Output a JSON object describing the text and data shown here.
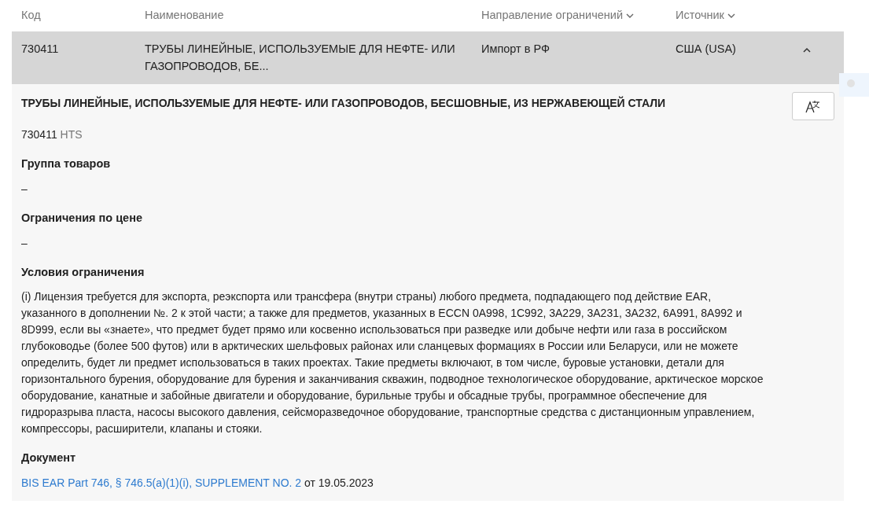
{
  "table": {
    "columns": [
      {
        "label": "Код",
        "sortable": false
      },
      {
        "label": "Наименование",
        "sortable": false
      },
      {
        "label": "Направление ограничений",
        "sortable": true
      },
      {
        "label": "Источник",
        "sortable": true
      }
    ],
    "rows": [
      {
        "cells": [
          "730411",
          "ТРУБЫ ЛИНЕЙНЫЕ, ИСПОЛЬЗУЕМЫЕ ДЛЯ НЕФТЕ- ИЛИ ГАЗОПРОВОДОВ, БЕ...",
          "Импорт в РФ",
          "США (USA)"
        ],
        "expanded": true,
        "selected": true,
        "detail": {
          "title": "ТРУБЫ ЛИНЕЙНЫЕ, ИСПОЛЬЗУЕМЫЕ ДЛЯ НЕФТЕ- ИЛИ ГАЗОПРОВОДОВ, БЕСШОВНЫЕ, ИЗ НЕРЖАВЕЮЩЕЙ СТАЛИ",
          "code": "730411",
          "code_system": "HTS",
          "sections": [
            {
              "heading": "Группа товаров",
              "text": "–"
            },
            {
              "heading": "Ограничения по цене",
              "text": "–"
            },
            {
              "heading": "Условия ограничения",
              "text": "(i) Лицензия требуется для экспорта, реэкспорта или трансфера (внутри страны) любого предмета, подпадающего под действие EAR, указанного в дополнении №. 2 к этой части; а также для предметов, указанных в ECCN 0A998, 1C992, 3A229, 3A231, 3A232, 6A991, 8A992 и 8D999, если вы «знаете», что предмет будет прямо или косвенно использоваться при разведке или добыче нефти или газа в российском глубоководье (более 500 футов) или в арктических шельфовых районах или сланцевых формациях в России или Беларуси, или не можете определить, будет ли предмет использоваться в таких проектах. Такие предметы включают, в том числе, буровые установки, детали для горизонтального бурения, оборудование для бурения и заканчивания скважин, подводное технологическое оборудование, арктическое морское оборудование, канатные и забойные двигатели и оборудование, бурильные трубы и обсадные трубы, программное обеспечение для гидроразрыва пласта, насосы высокого давления, сейсморазведочное оборудование, транспортные средства с дистанционным управлением, компрессоры, расширители, клапаны и стояки."
            }
          ],
          "document": {
            "heading": "Документ",
            "link": "BIS EAR Part 746, § 746.5(a)(1)(i), SUPPLEMENT NO. 2",
            "date": "от 19.05.2023"
          }
        }
      }
    ]
  }
}
